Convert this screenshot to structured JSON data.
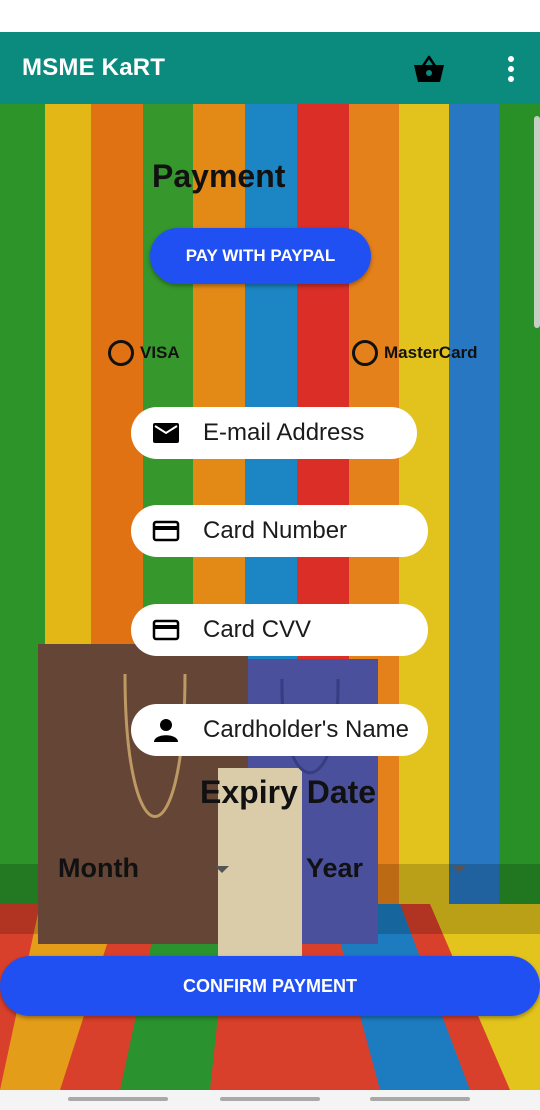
{
  "app": {
    "title": "MSME KaRT"
  },
  "appbar_icons": {
    "cart": "shopping-basket-icon",
    "menu": "more-vert-icon"
  },
  "payment": {
    "title": "Payment",
    "paypal_label": "PAY WITH PAYPAL",
    "card_types": [
      "VISA",
      "MasterCard"
    ]
  },
  "fields": {
    "email": {
      "icon": "mail-icon",
      "placeholder": "E-mail Address"
    },
    "card_number": {
      "icon": "credit-card-icon",
      "placeholder": "Card Number"
    },
    "card_cvv": {
      "icon": "credit-card-icon",
      "placeholder": "Card CVV"
    },
    "cardholder": {
      "icon": "person-icon",
      "placeholder": "Cardholder's Name"
    }
  },
  "expiry": {
    "title": "Expiry Date",
    "month_label": "Month",
    "year_label": "Year"
  },
  "confirm_label": "CONFIRM PAYMENT",
  "colors": {
    "app_bar": "#0b8a7e",
    "primary_button": "#2150f2"
  }
}
